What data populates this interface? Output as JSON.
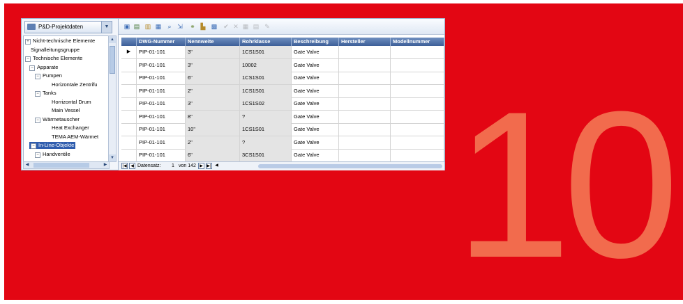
{
  "chapter_number": "10",
  "project": {
    "label": "P&D-Projektdaten"
  },
  "tree": {
    "items": [
      {
        "label": "Nicht-technische Elemente",
        "expander": "+"
      },
      {
        "label": "Signalleitungsgruppe",
        "expander": ""
      },
      {
        "label": "Technische Elemente",
        "expander": "−"
      },
      {
        "label": "Apparate",
        "expander": "−"
      },
      {
        "label": "Pumpen",
        "expander": "−"
      },
      {
        "label": "Horizontale Zentrifu",
        "expander": ""
      },
      {
        "label": "Tanks",
        "expander": "−"
      },
      {
        "label": "Horrizontal Drum",
        "expander": ""
      },
      {
        "label": "Main Vessel",
        "expander": ""
      },
      {
        "label": "Wärmetauscher",
        "expander": "−"
      },
      {
        "label": "Heat Exchanger",
        "expander": ""
      },
      {
        "label": "TEMA AEM-Wärmet",
        "expander": ""
      },
      {
        "label": "In-Line-Objekte",
        "expander": "−"
      },
      {
        "label": "Handventile",
        "expander": "−"
      }
    ]
  },
  "toolbar": {
    "buttons": [
      {
        "icon": "open-icon",
        "glyph": "▣"
      },
      {
        "icon": "save-icon",
        "glyph": "▤"
      },
      {
        "icon": "paste-icon",
        "glyph": "▥"
      },
      {
        "icon": "filter-icon",
        "glyph": "▦"
      },
      {
        "icon": "zoom-icon",
        "glyph": "⌕"
      },
      {
        "icon": "export-icon",
        "glyph": "⇲"
      },
      {
        "icon": "link-icon",
        "glyph": "⚭"
      },
      {
        "icon": "chart-icon",
        "glyph": "▙"
      },
      {
        "icon": "table-icon",
        "glyph": "▩"
      },
      {
        "icon": "check-icon",
        "glyph": "✔"
      },
      {
        "icon": "delete-icon",
        "glyph": "✕"
      },
      {
        "icon": "grid-icon",
        "glyph": "▦"
      },
      {
        "icon": "list-icon",
        "glyph": "▤"
      },
      {
        "icon": "edit-icon",
        "glyph": "✎"
      }
    ]
  },
  "grid": {
    "columns": [
      "DWG-Nummer",
      "Nennweite",
      "Rohrklasse",
      "Beschreibung",
      "Hersteller",
      "Modellnummer"
    ],
    "rows": [
      [
        "PIP-01-101",
        "3\"",
        "1CS1S01",
        "Gate Valve",
        "",
        ""
      ],
      [
        "PIP-01-101",
        "3\"",
        "10002",
        "Gate Valve",
        "",
        ""
      ],
      [
        "PIP-01-101",
        "6\"",
        "1CS1S01",
        "Gate Valve",
        "",
        ""
      ],
      [
        "PIP-01-101",
        "2\"",
        "1CS1S01",
        "Gate Valve",
        "",
        ""
      ],
      [
        "PIP-01-101",
        "3\"",
        "1CS1S02",
        "Gate Valve",
        "",
        ""
      ],
      [
        "PIP-01-101",
        "8\"",
        "?",
        "Gate Valve",
        "",
        ""
      ],
      [
        "PIP-01-101",
        "10\"",
        "1CS1S01",
        "Gate Valve",
        "",
        ""
      ],
      [
        "PIP-01-101",
        "2\"",
        "?",
        "Gate Valve",
        "",
        ""
      ],
      [
        "PIP-01-101",
        "6\"",
        "3CS1S01",
        "Gate Valve",
        "",
        ""
      ]
    ]
  },
  "navigator": {
    "label": "Datensatz:",
    "current": "1",
    "total": "von 142"
  }
}
